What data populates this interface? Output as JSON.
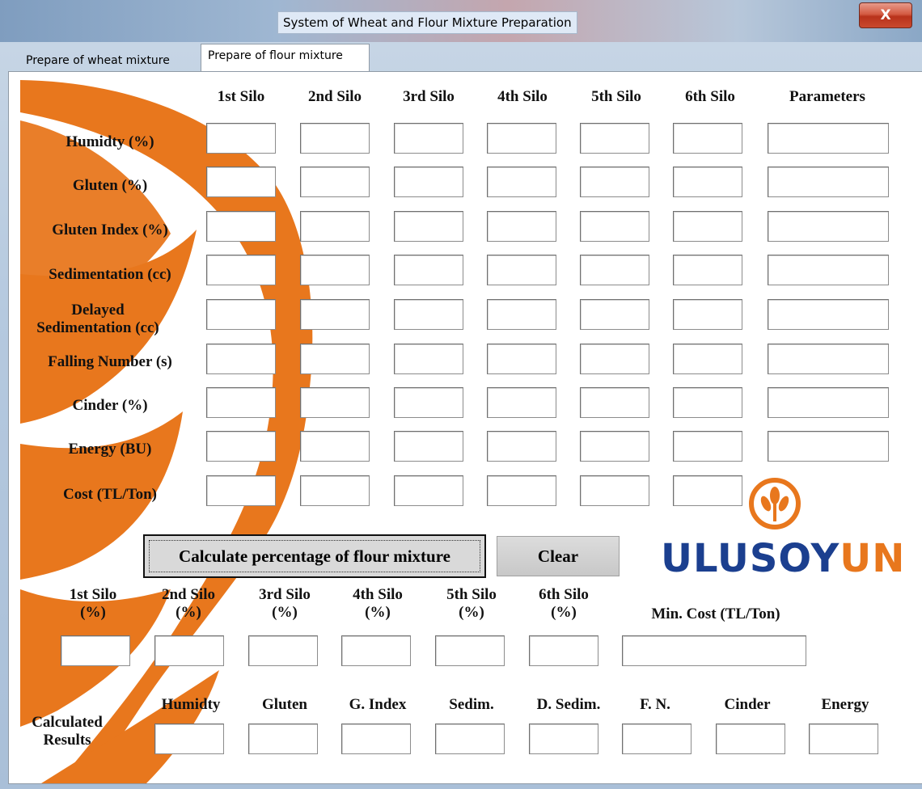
{
  "window": {
    "title": "System of Wheat and Flour Mixture Preparation",
    "close_glyph": "X"
  },
  "tabs": [
    {
      "label": "Prepare of wheat mixture",
      "active": false
    },
    {
      "label": "Prepare of flour mixture",
      "active": true
    }
  ],
  "columns": [
    "1st Silo",
    "2nd Silo",
    "3rd Silo",
    "4th Silo",
    "5th Silo",
    "6th Silo",
    "Parameters"
  ],
  "rows": [
    "Humidty (%)",
    "Gluten (%)",
    "Gluten Index (%)",
    "Sedimentation (cc)",
    "Delayed Sedimentation (cc)",
    "Falling Number (s)",
    "Cinder (%)",
    "Energy (BU)",
    "Cost (TL/Ton)"
  ],
  "actions": {
    "calculate": "Calculate percentage of flour mixture",
    "clear": "Clear"
  },
  "percentages": {
    "labels": [
      "1st Silo (%)",
      "2nd Silo (%)",
      "3rd Silo (%)",
      "4th Silo (%)",
      "5th Silo (%)",
      "6th Silo (%)"
    ],
    "min_cost_label": "Min. Cost (TL/Ton)"
  },
  "results": {
    "title": "Calculated Results",
    "labels": [
      "Humidty",
      "Gluten",
      "G. Index",
      "Sedim.",
      "D. Sedim.",
      "F. N.",
      "Cinder",
      "Energy"
    ]
  },
  "logo": {
    "part1": "ULUSOY",
    "part2": "UN"
  },
  "colors": {
    "brand_orange": "#e8771d",
    "brand_blue": "#1b3f8f"
  }
}
